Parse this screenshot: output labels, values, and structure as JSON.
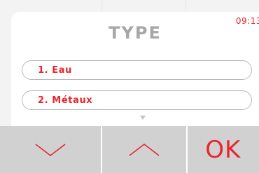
{
  "status": {
    "time": "09:13"
  },
  "screen": {
    "title": "TYPE",
    "options": [
      {
        "label": "1. Eau"
      },
      {
        "label": "2. Métaux"
      }
    ]
  },
  "buttons": {
    "down_icon": "chevron-down-icon",
    "up_icon": "chevron-up-icon",
    "ok_label": "OK"
  },
  "colors": {
    "accent": "#e8262c",
    "title_gray": "#a7a7a7",
    "button_bg": "#d1d1d1"
  }
}
